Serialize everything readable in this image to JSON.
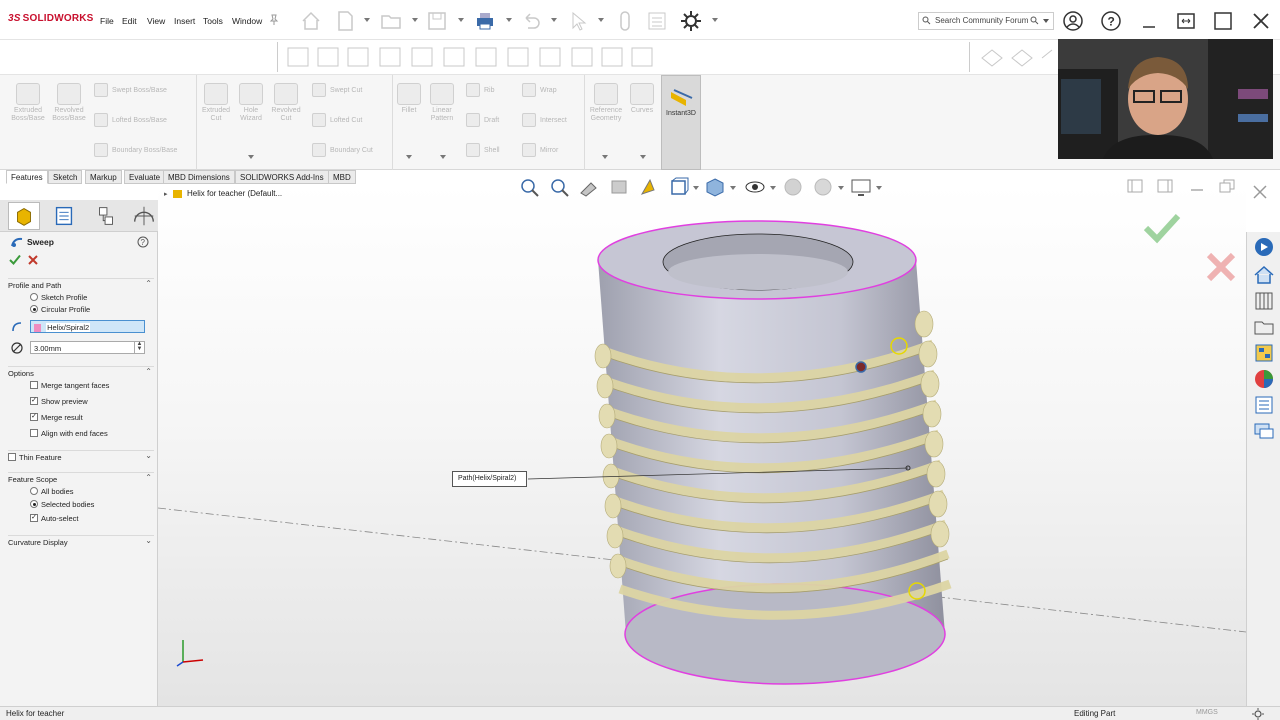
{
  "app": {
    "logo": "SOLIDWORKS",
    "logo_prefix": "3S"
  },
  "menu": [
    "File",
    "Edit",
    "View",
    "Insert",
    "Tools",
    "Window"
  ],
  "search": {
    "placeholder": "Search Community Forum"
  },
  "ribbon": {
    "groups": [
      {
        "label": "Extruded Boss/Base"
      },
      {
        "label": "Revolved Boss/Base"
      },
      {
        "label": "Swept Boss/Base"
      },
      {
        "label": "Lofted Boss/Base"
      },
      {
        "label": "Boundary Boss/Base"
      },
      {
        "label": "Extruded Cut"
      },
      {
        "label": "Hole Wizard"
      },
      {
        "label": "Revolved Cut"
      },
      {
        "label": "Swept Cut"
      },
      {
        "label": "Lofted Cut"
      },
      {
        "label": "Boundary Cut"
      },
      {
        "label": "Fillet"
      },
      {
        "label": "Linear Pattern"
      },
      {
        "label": "Rib"
      },
      {
        "label": "Wrap"
      },
      {
        "label": "Draft"
      },
      {
        "label": "Intersect"
      },
      {
        "label": "Shell"
      },
      {
        "label": "Mirror"
      },
      {
        "label": "Reference Geometry"
      },
      {
        "label": "Curves"
      },
      {
        "label": "Instant3D"
      }
    ]
  },
  "tabs": [
    {
      "label": "Features",
      "active": true
    },
    {
      "label": "Sketch"
    },
    {
      "label": "Markup"
    },
    {
      "label": "Evaluate"
    },
    {
      "label": "MBD Dimensions"
    },
    {
      "label": "SOLIDWORKS Add-Ins"
    },
    {
      "label": "MBD"
    }
  ],
  "tree": {
    "root_label": "Helix for teacher  (Default..."
  },
  "property_manager": {
    "title": "Sweep",
    "profile_and_path": {
      "header": "Profile and Path",
      "sketch_profile": "Sketch Profile",
      "circular_profile": "Circular Profile",
      "selected": "Circular Profile",
      "path_value": "Helix/Spiral2",
      "diameter_value": "3.00mm"
    },
    "options": {
      "header": "Options",
      "merge_tangent_faces": {
        "label": "Merge tangent faces",
        "checked": false
      },
      "show_preview": {
        "label": "Show preview",
        "checked": true
      },
      "merge_result": {
        "label": "Merge result",
        "checked": true
      },
      "align_with_end_faces": {
        "label": "Align with end faces",
        "checked": false
      }
    },
    "thin_feature": {
      "label": "Thin Feature",
      "checked": false
    },
    "feature_scope": {
      "header": "Feature Scope",
      "all_bodies": "All bodies",
      "selected_bodies": "Selected bodies",
      "selected": "Selected bodies",
      "auto_select": {
        "label": "Auto-select",
        "checked": true
      }
    },
    "curvature_display": {
      "header": "Curvature Display"
    }
  },
  "viewport": {
    "callout": "Path(Helix/Spiral2)"
  },
  "status": {
    "left": "Helix for teacher",
    "editing": "Editing Part",
    "units": "MMGS"
  },
  "colors": {
    "accent_red": "#c8102e",
    "edge_magenta": "#e040e0",
    "body": "#c9cad6",
    "sweep_preview": "#e6dfb0",
    "ok_green": "#3a9a3a",
    "cancel_red": "#c0392b"
  }
}
